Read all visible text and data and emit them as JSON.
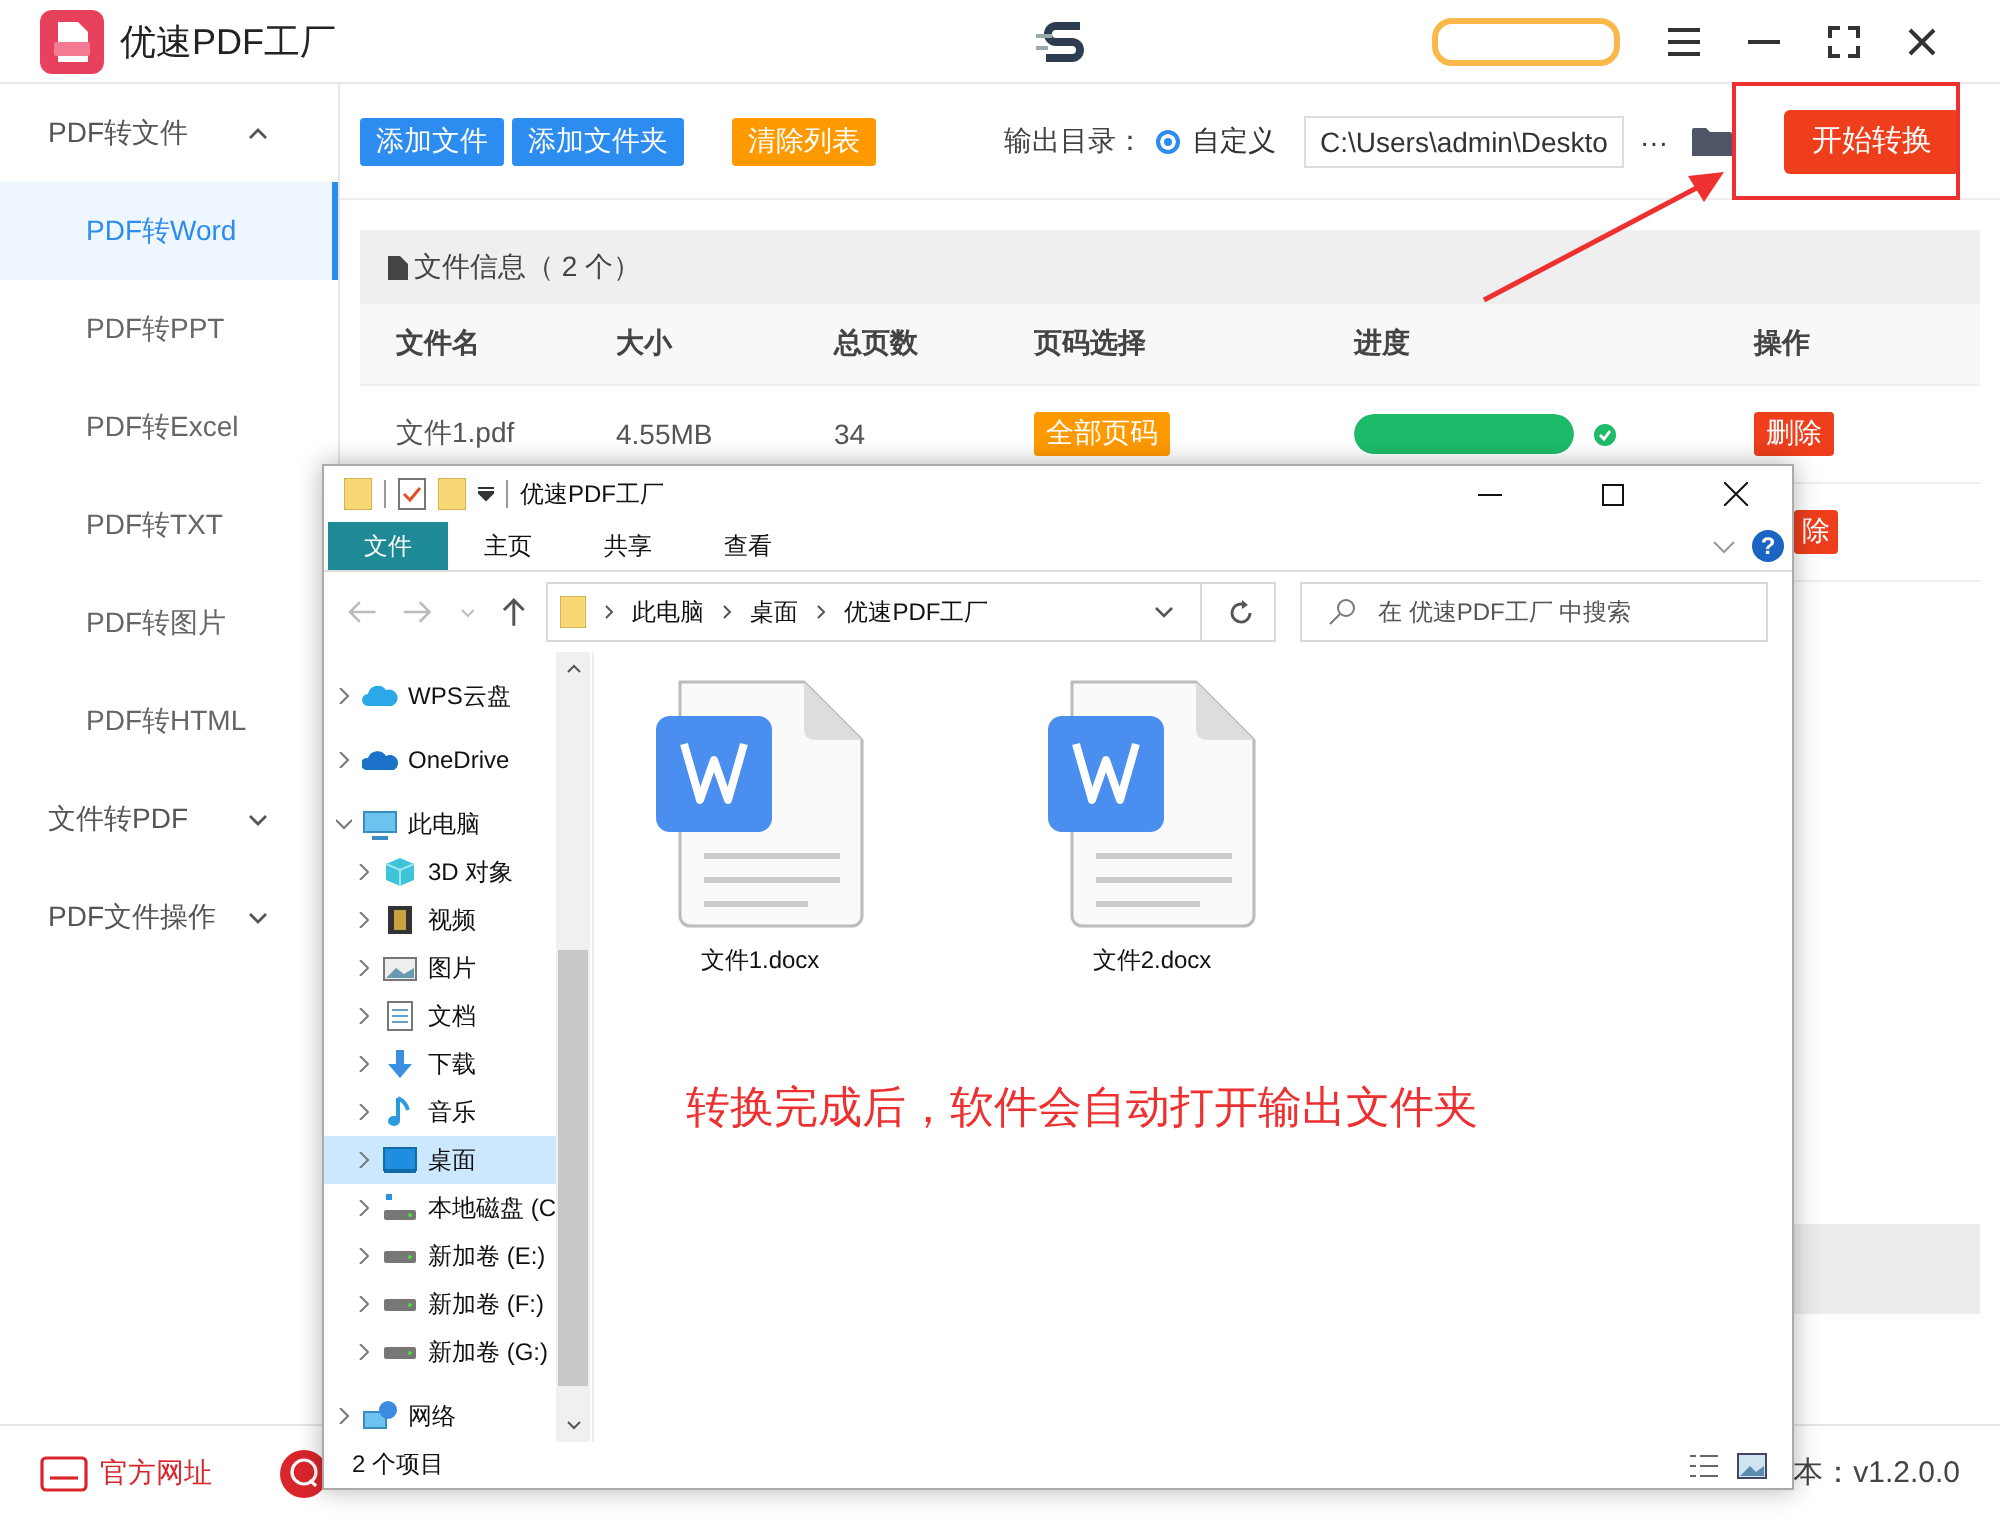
{
  "app": {
    "title": "优速PDF工厂"
  },
  "sidebar": [
    {
      "label": "PDF转文件",
      "expanded": true,
      "children": [
        {
          "label": "PDF转Word",
          "selected": true
        },
        {
          "label": "PDF转PPT",
          "selected": false
        },
        {
          "label": "PDF转Excel",
          "selected": false
        },
        {
          "label": "PDF转TXT",
          "selected": false
        },
        {
          "label": "PDF转图片",
          "selected": false
        },
        {
          "label": "PDF转HTML",
          "selected": false
        }
      ]
    },
    {
      "label": "文件转PDF",
      "expanded": false
    },
    {
      "label": "PDF文件操作",
      "expanded": false
    }
  ],
  "toolbar": {
    "buttons": [
      {
        "label": "添加文件",
        "kind": "primary"
      },
      {
        "label": "添加文件夹",
        "kind": "primary"
      },
      {
        "label": "清除列表",
        "kind": "warning"
      }
    ],
    "output_label": "输出目录：",
    "radio": {
      "label": "自定义",
      "selected": true
    },
    "path": "C:\\Users\\admin\\Deskto",
    "more": "···",
    "start": "开始转换"
  },
  "file_panel": {
    "title": "文件信息（ 2 个）",
    "columns": [
      "文件名",
      "大小",
      "总页数",
      "页码选择",
      "进度",
      "操作"
    ],
    "rows": [
      {
        "name": "文件1.pdf",
        "size": "4.55MB",
        "pages": "34",
        "page_select": "全部页码",
        "level": 1,
        "done": true,
        "action": "删除"
      },
      {
        "action": "除"
      }
    ]
  },
  "footer": {
    "website": "官方网址",
    "version": "本：v1.2.0.0"
  },
  "explorer": {
    "title": "优速PDF工厂",
    "ribbon_tabs": [
      {
        "label": "文件",
        "selected": true
      },
      {
        "label": "主页",
        "selected": false
      },
      {
        "label": "共享",
        "selected": false
      },
      {
        "label": "查看",
        "selected": false
      }
    ],
    "help": "?",
    "breadcrumb": [
      "此电脑",
      "桌面",
      "优速PDF工厂"
    ],
    "search_placeholder": "在 优速PDF工厂 中搜索",
    "nav": [
      {
        "label": "WPS云盘",
        "kind": "cloud",
        "expanded": false,
        "selected": false
      },
      {
        "label": "OneDrive",
        "kind": "onedrive",
        "expanded": false,
        "selected": false
      },
      {
        "label": "此电脑",
        "kind": "pc",
        "expanded": true,
        "selected": false,
        "children": [
          {
            "label": "3D 对象",
            "kind": "cube",
            "selected": false
          },
          {
            "label": "视频",
            "kind": "film",
            "selected": false
          },
          {
            "label": "图片",
            "kind": "image",
            "selected": false
          },
          {
            "label": "文档",
            "kind": "doc",
            "selected": false
          },
          {
            "label": "下载",
            "kind": "download",
            "selected": false
          },
          {
            "label": "音乐",
            "kind": "music",
            "selected": false
          },
          {
            "label": "桌面",
            "kind": "desktop",
            "selected": true
          },
          {
            "label": "本地磁盘 (C",
            "kind": "disk-c",
            "selected": false
          },
          {
            "label": "新加卷 (E:)",
            "kind": "disk",
            "selected": false
          },
          {
            "label": "新加卷 (F:)",
            "kind": "disk",
            "selected": false
          },
          {
            "label": "新加卷 (G:)",
            "kind": "disk",
            "selected": false
          }
        ]
      },
      {
        "label": "网络",
        "kind": "network",
        "expanded": false,
        "selected": false
      }
    ],
    "files": [
      {
        "name": "文件1.docx"
      },
      {
        "name": "文件2.docx"
      }
    ],
    "caption": "转换完成后，软件会自动打开输出文件夹",
    "status": "2 个项目"
  }
}
